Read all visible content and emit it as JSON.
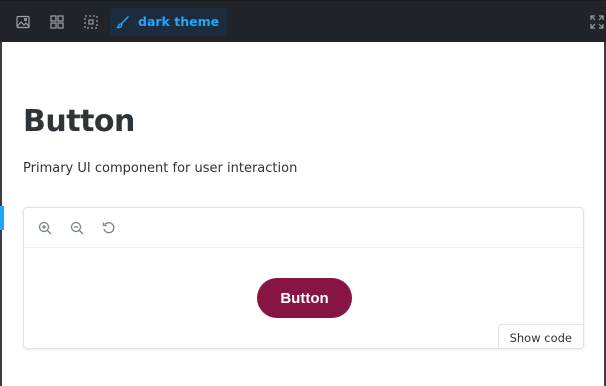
{
  "toolbar": {
    "buttons": [
      {
        "icon": "image-icon"
      },
      {
        "icon": "grid-icon"
      },
      {
        "icon": "outline-icon"
      }
    ],
    "theme_toggle": {
      "icon": "paintbrush-icon",
      "label": "dark theme"
    },
    "fullscreen_icon": "expand-icon"
  },
  "docs": {
    "title": "Button",
    "description": "Primary UI component for user interaction"
  },
  "preview": {
    "zoom_controls": [
      {
        "icon": "zoom-in-icon"
      },
      {
        "icon": "zoom-out-icon"
      },
      {
        "icon": "zoom-reset-icon"
      }
    ],
    "button_label": "Button",
    "show_code_label": "Show code"
  },
  "colors": {
    "toolbar_bg": "#202327",
    "accent": "#1ea7fd",
    "primary_button": "#871543"
  }
}
